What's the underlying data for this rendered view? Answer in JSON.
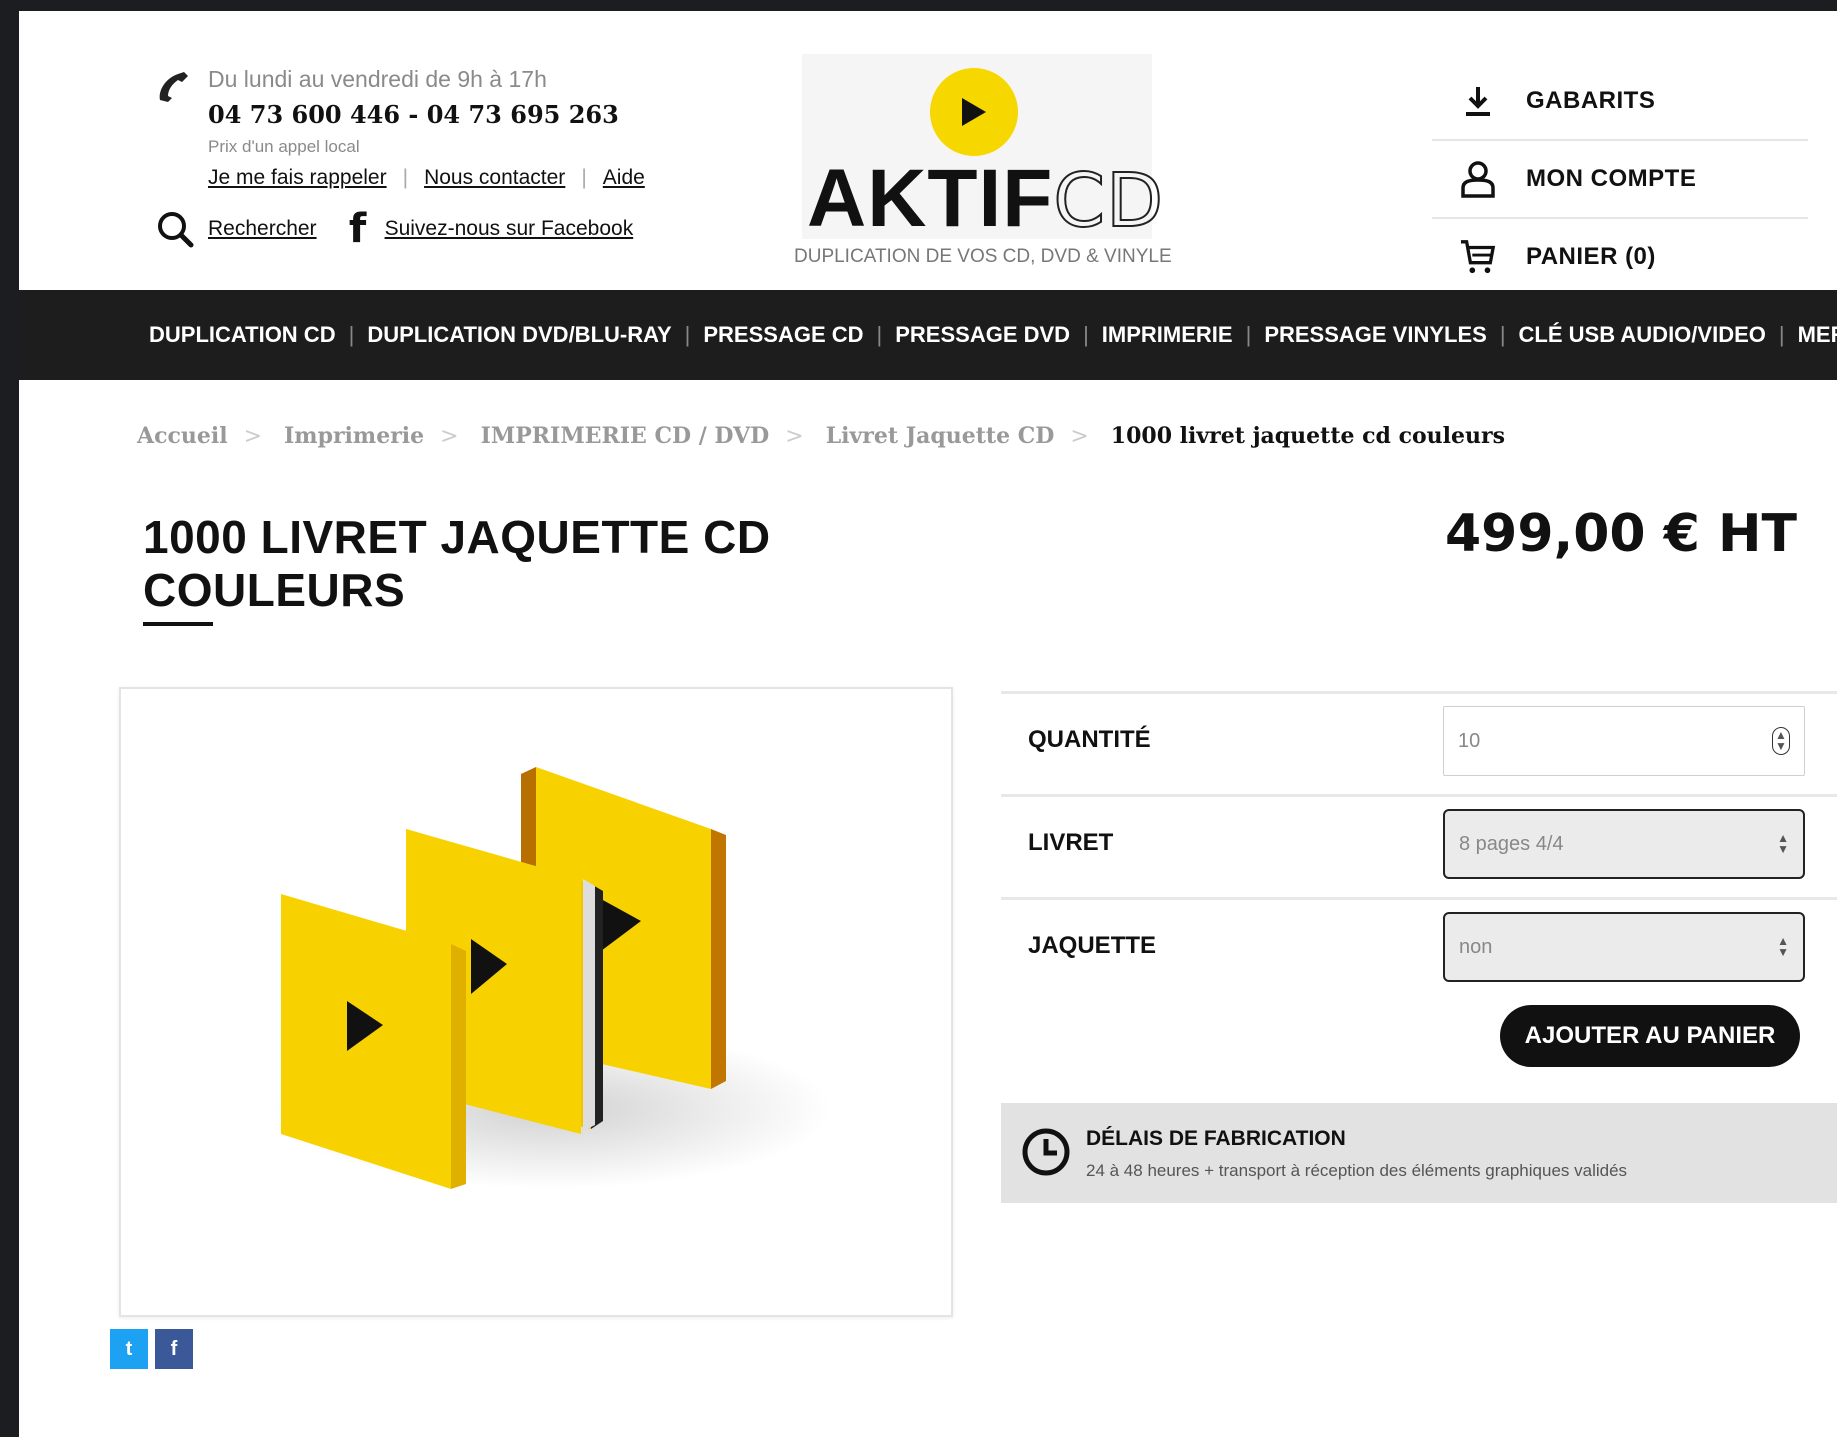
{
  "header": {
    "hours": "Du lundi au vendredi de 9h à 17h",
    "phones": "04 73 600 446 - 04 73 695 263",
    "local_call": "Prix d'un appel local",
    "links": [
      "Je me fais rappeler",
      "Nous contacter",
      "Aide"
    ],
    "search_label": "Rechercher",
    "facebook_label": "Suivez-nous sur Facebook",
    "logo_bold": "AKTIF",
    "logo_light": "CD",
    "tagline": "DUPLICATION DE VOS CD, DVD & VINYLE",
    "right_menu": [
      {
        "label": "GABARITS",
        "icon": "download-icon"
      },
      {
        "label": "MON COMPTE",
        "icon": "user-icon"
      },
      {
        "label": "PANIER (0)",
        "icon": "cart-icon"
      }
    ]
  },
  "nav": {
    "items": [
      "DUPLICATION CD",
      "DUPLICATION DVD/BLU-RAY",
      "PRESSAGE CD",
      "PRESSAGE DVD",
      "IMPRIMERIE",
      "PRESSAGE VINYLES",
      "CLÉ USB AUDIO/VIDEO",
      "MERCHANDISING"
    ]
  },
  "breadcrumb": {
    "items": [
      "Accueil",
      "Imprimerie",
      "IMPRIMERIE CD / DVD",
      "Livret Jaquette CD"
    ],
    "current": "1000 livret jaquette cd couleurs"
  },
  "product": {
    "title_line1": "1000 LIVRET JAQUETTE CD",
    "title_line2": "COULEURS",
    "price": "499,00 € HT"
  },
  "options": {
    "quantity_label": "QUANTITÉ",
    "quantity_value": "10",
    "livret_label": "LIVRET",
    "livret_value": "8 pages 4/4",
    "jaquette_label": "JAQUETTE",
    "jaquette_value": "non",
    "add_to_cart": "AJOUTER AU PANIER"
  },
  "delay": {
    "title": "DÉLAIS DE FABRICATION",
    "text": "24 à 48 heures + transport à réception des éléments graphiques validés"
  },
  "share": {
    "twitter_glyph": "t",
    "facebook_glyph": "f"
  },
  "colors": {
    "accent_yellow": "#f7d700",
    "nav_bg": "#1d1d1d"
  }
}
